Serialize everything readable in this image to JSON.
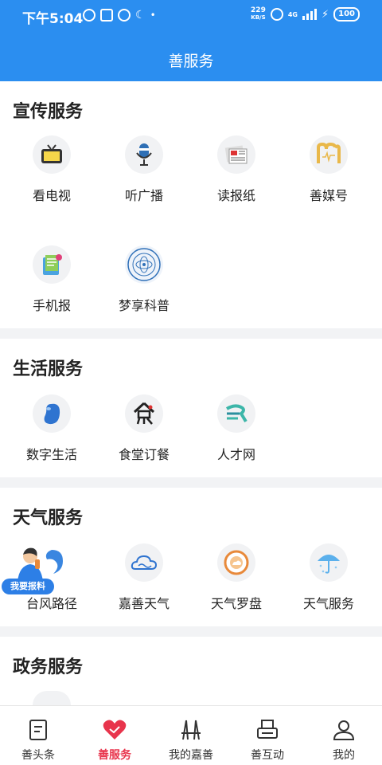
{
  "status_bar": {
    "time": "下午5:04",
    "net_speed_value": "229",
    "net_speed_unit": "KB/S",
    "network": "4G",
    "battery": "100"
  },
  "header": {
    "title": "善服务"
  },
  "sections": [
    {
      "title": "宣传服务",
      "items": [
        {
          "label": "看电视",
          "icon": "tv-icon"
        },
        {
          "label": "听广播",
          "icon": "microphone-icon"
        },
        {
          "label": "读报纸",
          "icon": "newspaper-icon"
        },
        {
          "label": "善媒号",
          "icon": "media-account-icon"
        },
        {
          "label": "手机报",
          "icon": "phone-newspaper-icon"
        },
        {
          "label": "梦享科普",
          "icon": "science-emblem-icon"
        }
      ]
    },
    {
      "title": "生活服务",
      "items": [
        {
          "label": "数字生活",
          "icon": "digital-life-icon"
        },
        {
          "label": "食堂订餐",
          "icon": "canteen-food-icon"
        },
        {
          "label": "人才网",
          "icon": "talent-network-icon"
        }
      ]
    },
    {
      "title": "天气服务",
      "items": [
        {
          "label": "台风路径",
          "icon": "typhoon-icon"
        },
        {
          "label": "嘉善天气",
          "icon": "cloud-icon"
        },
        {
          "label": "天气罗盘",
          "icon": "weather-compass-icon"
        },
        {
          "label": "天气服务",
          "icon": "umbrella-icon"
        }
      ]
    },
    {
      "title": "政务服务",
      "items": []
    }
  ],
  "floating": {
    "report_label": "我要报料"
  },
  "tabs": [
    {
      "label": "善头条",
      "icon": "news-icon",
      "active": false
    },
    {
      "label": "善服务",
      "icon": "heart-icon",
      "active": true
    },
    {
      "label": "我的嘉善",
      "icon": "bridge-icon",
      "active": false
    },
    {
      "label": "善互动",
      "icon": "interaction-icon",
      "active": false
    },
    {
      "label": "我的",
      "icon": "profile-icon",
      "active": false
    }
  ],
  "colors": {
    "header_blue": "#2b8ef0",
    "active_tab": "#e8344c",
    "report_blue": "#2d7fe6"
  }
}
